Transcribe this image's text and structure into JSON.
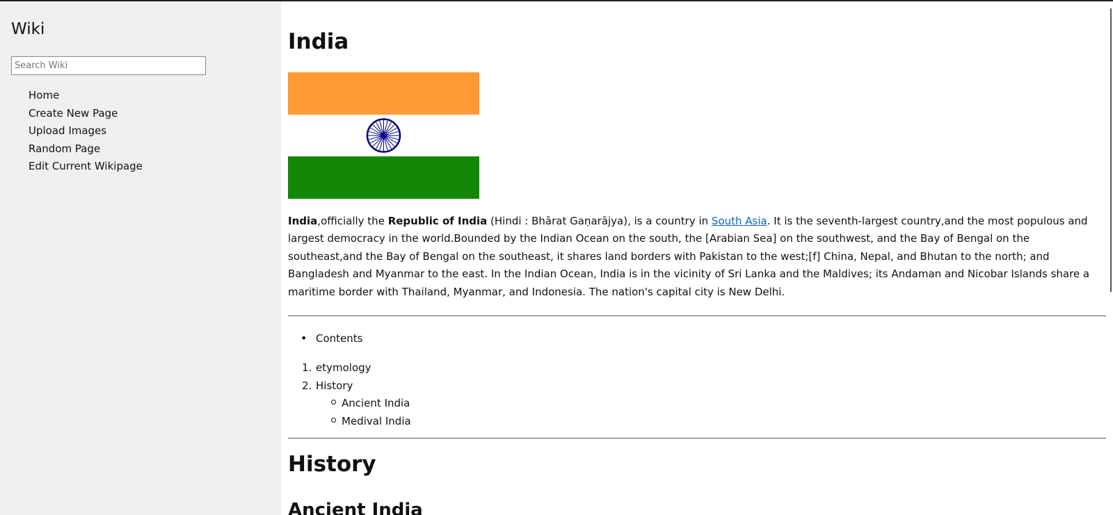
{
  "sidebar": {
    "title": "Wiki",
    "search_placeholder": "Search Wiki",
    "nav": [
      "Home",
      "Create New Page",
      "Upload Images",
      "Random Page",
      "Edit Current Wikipage"
    ]
  },
  "article": {
    "title": "India",
    "intro": {
      "term": "India",
      "part1": ",officially the ",
      "official_name": "Republic of India",
      "part2": " (Hindi : Bhārat Gaṇarājya), is a country in ",
      "link": "South Asia",
      "part3": ". It is the seventh-largest country,and the most populous and largest democracy in the world.Bounded by the Indian Ocean on the south, the [Arabian Sea] on the southwest, and the Bay of Bengal on the southeast,and the Bay of Bengal on the southeast, it shares land borders with Pakistan to the west;[f] China, Nepal, and Bhutan to the north; and Bangladesh and Myanmar to the east. In the Indian Ocean, India is in the vicinity of Sri Lanka and the Maldives; its Andaman and Nicobar Islands share a maritime border with Thailand, Myanmar, and Indonesia. The nation's capital city is New Delhi."
    },
    "contents_label": "Contents",
    "toc": [
      {
        "num": "1.",
        "label": "etymology"
      },
      {
        "num": "2.",
        "label": "History",
        "children": [
          "Ancient India",
          "Medival India"
        ]
      }
    ],
    "history_heading": "History",
    "sub_heading": "Ancient India"
  },
  "colors": {
    "sidebar_bg": "#f0f0f0",
    "link": "#0a66c2",
    "flag_saffron": "#ff9933",
    "flag_white": "#ffffff",
    "flag_green": "#138808",
    "chakra": "#000080"
  }
}
